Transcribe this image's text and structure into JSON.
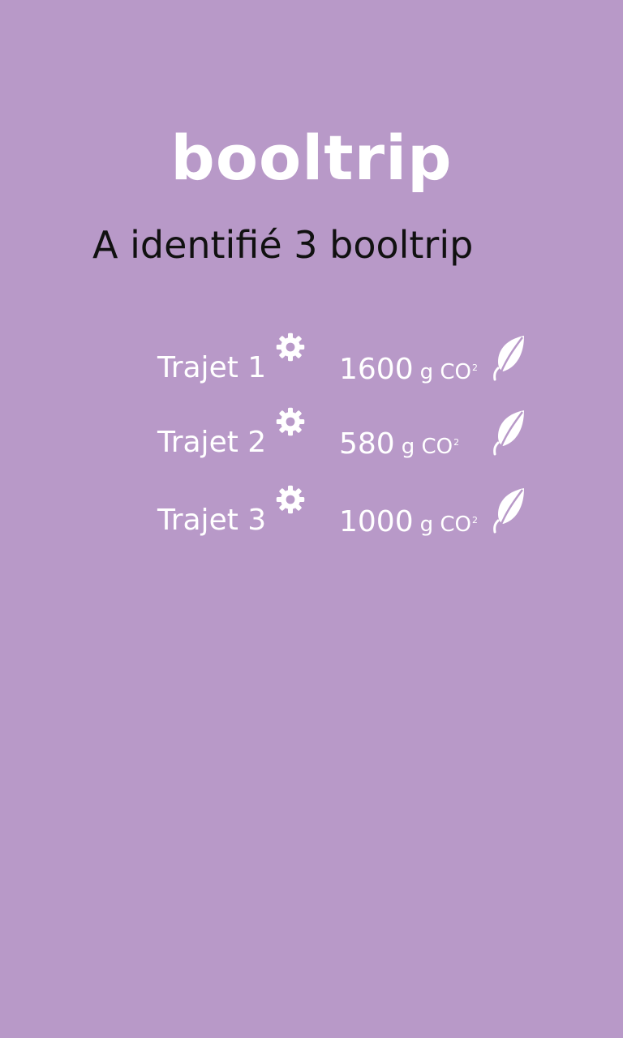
{
  "app": {
    "logo_text": "booltrip",
    "headline": "A identifié 3 booltrip"
  },
  "colors": {
    "background": "#b899c8",
    "foreground": "#ffffff",
    "headline": "#111111"
  },
  "trips": [
    {
      "label": "Trajet 1",
      "co2_value": "1600",
      "unit": "g CO",
      "unit_sub": "2",
      "settings_icon": "gear-icon",
      "eco_icon": "leaf-icon"
    },
    {
      "label": "Trajet 2",
      "co2_value": "580",
      "unit": "g CO",
      "unit_sub": "2",
      "settings_icon": "gear-icon",
      "eco_icon": "leaf-icon"
    },
    {
      "label": "Trajet 3",
      "co2_value": "1000",
      "unit": "g CO",
      "unit_sub": "2",
      "settings_icon": "gear-icon",
      "eco_icon": "leaf-icon"
    }
  ]
}
